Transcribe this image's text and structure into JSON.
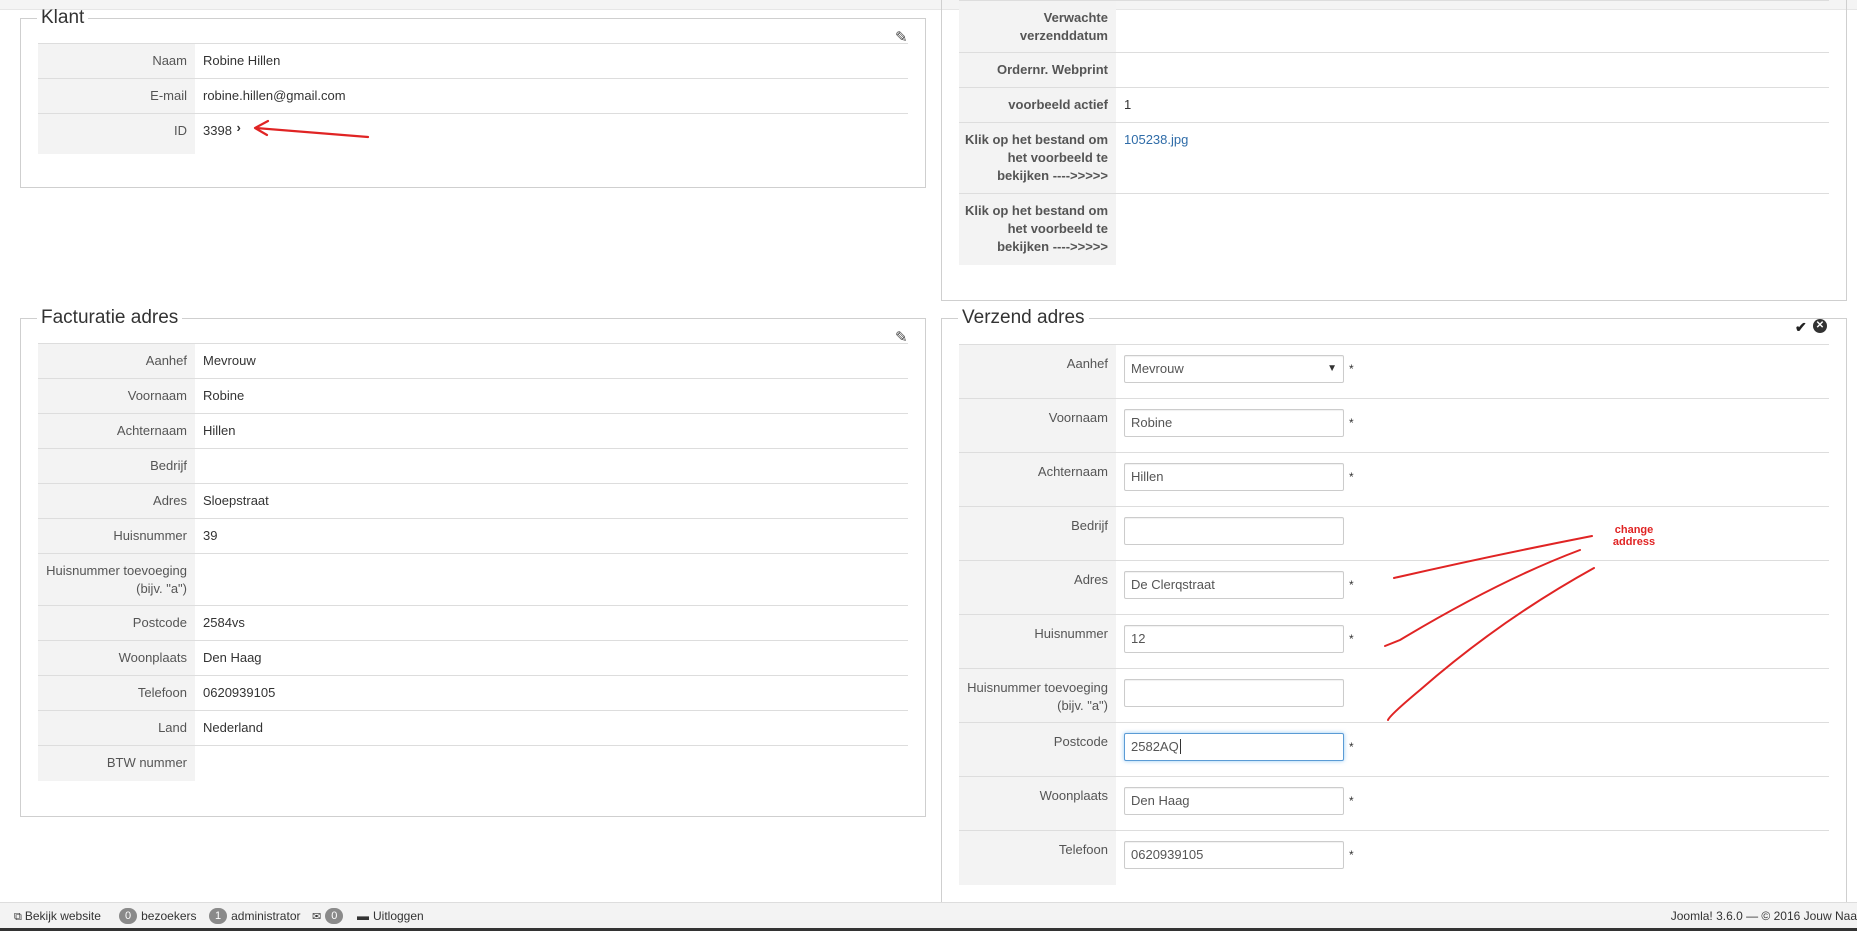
{
  "klant": {
    "title": "Klant",
    "rows": [
      {
        "label": "Naam",
        "value": "Robine Hillen"
      },
      {
        "label": "E-mail",
        "value": "robine.hillen@gmail.com"
      },
      {
        "label": "ID",
        "value": "3398"
      }
    ]
  },
  "order": {
    "rows": [
      {
        "label": "Verwachte verzenddatum",
        "value": ""
      },
      {
        "label": "Ordernr. Webprint",
        "value": ""
      },
      {
        "label": "voorbeeld actief",
        "value": "1"
      },
      {
        "label": "Klik op het bestand om het voorbeeld te bekijken ---->>>>>",
        "value": "105238.jpg"
      },
      {
        "label": "Klik op het bestand om het voorbeeld te bekijken ---->>>>>",
        "value": ""
      }
    ]
  },
  "billing": {
    "title": "Facturatie adres",
    "rows": [
      {
        "label": "Aanhef",
        "value": "Mevrouw"
      },
      {
        "label": "Voornaam",
        "value": "Robine"
      },
      {
        "label": "Achternaam",
        "value": "Hillen"
      },
      {
        "label": "Bedrijf",
        "value": ""
      },
      {
        "label": "Adres",
        "value": "Sloepstraat"
      },
      {
        "label": "Huisnummer",
        "value": "39"
      },
      {
        "label": "Huisnummer toevoeging (bijv. \"a\")",
        "value": ""
      },
      {
        "label": "Postcode",
        "value": "2584vs"
      },
      {
        "label": "Woonplaats",
        "value": "Den Haag"
      },
      {
        "label": "Telefoon",
        "value": "0620939105"
      },
      {
        "label": "Land",
        "value": "Nederland"
      },
      {
        "label": "BTW nummer",
        "value": ""
      }
    ]
  },
  "shipping": {
    "title": "Verzend adres",
    "required_mark": "*",
    "rows": [
      {
        "label": "Aanhef",
        "value": "Mevrouw",
        "type": "select",
        "required": true
      },
      {
        "label": "Voornaam",
        "value": "Robine",
        "type": "text",
        "required": true
      },
      {
        "label": "Achternaam",
        "value": "Hillen",
        "type": "text",
        "required": true
      },
      {
        "label": "Bedrijf",
        "value": "",
        "type": "text",
        "required": false
      },
      {
        "label": "Adres",
        "value": "De Clerqstraat",
        "type": "text",
        "required": true
      },
      {
        "label": "Huisnummer",
        "value": "12",
        "type": "text",
        "required": true
      },
      {
        "label": "Huisnummer toevoeging (bijv. \"a\")",
        "value": "",
        "type": "text",
        "required": false
      },
      {
        "label": "Postcode",
        "value": "2582AQ",
        "type": "text",
        "required": true,
        "focused": true
      },
      {
        "label": "Woonplaats",
        "value": "Den Haag",
        "type": "text",
        "required": true
      },
      {
        "label": "Telefoon",
        "value": "0620939105",
        "type": "text",
        "required": true
      }
    ]
  },
  "annotation": {
    "text": "change address",
    "color": "#e02424"
  },
  "statusbar": {
    "view_site": "Bekijk website",
    "visitors_count": "0",
    "visitors_label": "bezoekers",
    "admin_count": "1",
    "admin_label": "administrator",
    "messages_count": "0",
    "logout": "Uitloggen",
    "footer": "Joomla! 3.6.0 — © 2016 Jouw Naa"
  }
}
